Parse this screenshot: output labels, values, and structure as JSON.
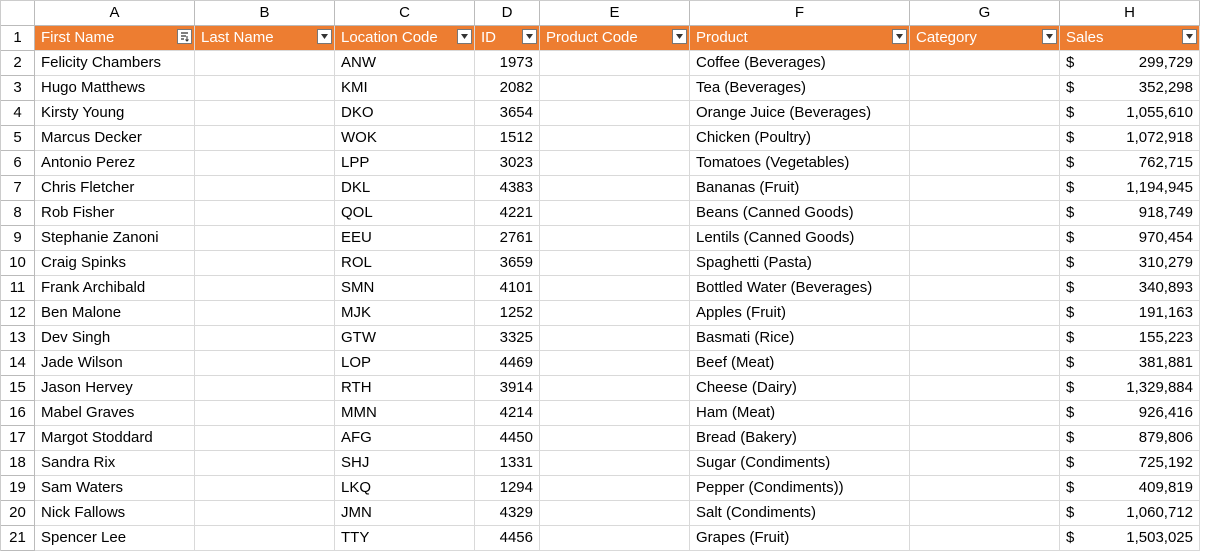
{
  "columns": [
    "A",
    "B",
    "C",
    "D",
    "E",
    "F",
    "G",
    "H"
  ],
  "headers": {
    "A": "First Name",
    "B": "Last Name",
    "C": "Location Code",
    "D": "ID",
    "E": "Product Code",
    "F": "Product",
    "G": "Category",
    "H": "Sales"
  },
  "sorted_column": "A",
  "currency_symbol": "$",
  "chart_data": {
    "type": "table",
    "columns": [
      "First Name",
      "Last Name",
      "Location Code",
      "ID",
      "Product Code",
      "Product",
      "Category",
      "Sales"
    ],
    "rows": [
      {
        "first": "Felicity Chambers",
        "last": "",
        "loc": "ANW",
        "id": 1973,
        "pcode": "",
        "product": "Coffee (Beverages)",
        "cat": "",
        "sales": 299729
      },
      {
        "first": "Hugo Matthews",
        "last": "",
        "loc": "KMI",
        "id": 2082,
        "pcode": "",
        "product": "Tea (Beverages)",
        "cat": "",
        "sales": 352298
      },
      {
        "first": "Kirsty Young",
        "last": "",
        "loc": "DKO",
        "id": 3654,
        "pcode": "",
        "product": "Orange Juice (Beverages)",
        "cat": "",
        "sales": 1055610
      },
      {
        "first": "Marcus Decker",
        "last": "",
        "loc": "WOK",
        "id": 1512,
        "pcode": "",
        "product": "Chicken (Poultry)",
        "cat": "",
        "sales": 1072918
      },
      {
        "first": "Antonio Perez",
        "last": "",
        "loc": "LPP",
        "id": 3023,
        "pcode": "",
        "product": "Tomatoes (Vegetables)",
        "cat": "",
        "sales": 762715
      },
      {
        "first": "Chris Fletcher",
        "last": "",
        "loc": "DKL",
        "id": 4383,
        "pcode": "",
        "product": "Bananas (Fruit)",
        "cat": "",
        "sales": 1194945
      },
      {
        "first": "Rob Fisher",
        "last": "",
        "loc": "QOL",
        "id": 4221,
        "pcode": "",
        "product": "Beans (Canned Goods)",
        "cat": "",
        "sales": 918749
      },
      {
        "first": "Stephanie Zanoni",
        "last": "",
        "loc": "EEU",
        "id": 2761,
        "pcode": "",
        "product": "Lentils (Canned Goods)",
        "cat": "",
        "sales": 970454
      },
      {
        "first": "Craig Spinks",
        "last": "",
        "loc": "ROL",
        "id": 3659,
        "pcode": "",
        "product": "Spaghetti (Pasta)",
        "cat": "",
        "sales": 310279
      },
      {
        "first": "Frank Archibald",
        "last": "",
        "loc": "SMN",
        "id": 4101,
        "pcode": "",
        "product": "Bottled Water (Beverages)",
        "cat": "",
        "sales": 340893
      },
      {
        "first": "Ben Malone",
        "last": "",
        "loc": "MJK",
        "id": 1252,
        "pcode": "",
        "product": "Apples (Fruit)",
        "cat": "",
        "sales": 191163
      },
      {
        "first": "Dev Singh",
        "last": "",
        "loc": "GTW",
        "id": 3325,
        "pcode": "",
        "product": "Basmati (Rice)",
        "cat": "",
        "sales": 155223
      },
      {
        "first": "Jade Wilson",
        "last": "",
        "loc": "LOP",
        "id": 4469,
        "pcode": "",
        "product": "Beef (Meat)",
        "cat": "",
        "sales": 381881
      },
      {
        "first": "Jason Hervey",
        "last": "",
        "loc": "RTH",
        "id": 3914,
        "pcode": "",
        "product": "Cheese (Dairy)",
        "cat": "",
        "sales": 1329884
      },
      {
        "first": "Mabel Graves",
        "last": "",
        "loc": "MMN",
        "id": 4214,
        "pcode": "",
        "product": "Ham (Meat)",
        "cat": "",
        "sales": 926416
      },
      {
        "first": "Margot Stoddard",
        "last": "",
        "loc": "AFG",
        "id": 4450,
        "pcode": "",
        "product": "Bread (Bakery)",
        "cat": "",
        "sales": 879806
      },
      {
        "first": "Sandra Rix",
        "last": "",
        "loc": "SHJ",
        "id": 1331,
        "pcode": "",
        "product": "Sugar (Condiments)",
        "cat": "",
        "sales": 725192
      },
      {
        "first": "Sam Waters",
        "last": "",
        "loc": "LKQ",
        "id": 1294,
        "pcode": "",
        "product": "Pepper (Condiments))",
        "cat": "",
        "sales": 409819
      },
      {
        "first": "Nick Fallows",
        "last": "",
        "loc": "JMN",
        "id": 4329,
        "pcode": "",
        "product": "Salt (Condiments)",
        "cat": "",
        "sales": 1060712
      },
      {
        "first": "Spencer Lee",
        "last": "",
        "loc": "TTY",
        "id": 4456,
        "pcode": "",
        "product": "Grapes (Fruit)",
        "cat": "",
        "sales": 1503025
      }
    ]
  }
}
